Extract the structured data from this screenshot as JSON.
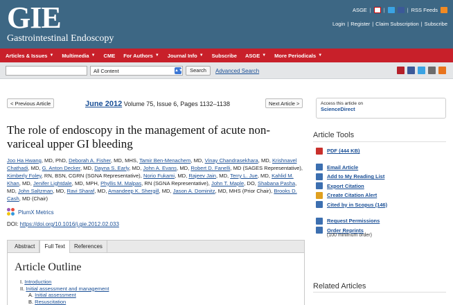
{
  "header": {
    "logo": "GIE",
    "logo_subtitle": "Gastrointestinal Endoscopy",
    "top_links": {
      "asge": "ASGE",
      "rss": "RSS Feeds"
    },
    "user_links": [
      "Login",
      "Register",
      "Claim Subscription",
      "Subscribe"
    ]
  },
  "nav": [
    {
      "label": "Articles & Issues",
      "caret": true
    },
    {
      "label": "Multimedia",
      "caret": true
    },
    {
      "label": "CME",
      "caret": false
    },
    {
      "label": "For Authors",
      "caret": true
    },
    {
      "label": "Journal Info",
      "caret": true
    },
    {
      "label": "Subscribe",
      "caret": false
    },
    {
      "label": "ASGE",
      "caret": true
    },
    {
      "label": "More Periodicals",
      "caret": true
    }
  ],
  "search": {
    "input_value": "",
    "scope": "All Content",
    "button": "Search",
    "advanced": "Advanced Search"
  },
  "share_colors": [
    "#b5202a",
    "#3b5998",
    "#3aa3e3",
    "#6c6c6c",
    "#e8741e"
  ],
  "article_nav": {
    "prev": "< Previous Article",
    "next": "Next Article >",
    "issue_link": "June 2012",
    "issue_rest": " Volume 75, Issue 6, Pages 1132–1138"
  },
  "access_box": {
    "text": "Access this article on",
    "link": "ScienceDirect"
  },
  "article": {
    "title": "The role of endoscopy in the management of acute non-variceal upper GI bleeding",
    "plumx": "PlumX Metrics",
    "doi_label": "DOI: ",
    "doi": "https://doi.org/10.1016/j.gie.2012.02.033"
  },
  "authors": [
    {
      "name": "Joo Ha Hwang",
      "suffix": ", MD, PhD, "
    },
    {
      "name": "Deborah A. Fisher",
      "suffix": ", MD, MHS, "
    },
    {
      "name": "Tamir Ben-Menachem",
      "suffix": ", MD, "
    },
    {
      "name": "Vinay Chandrasekhara",
      "suffix": ", MD, "
    },
    {
      "name": "Krishnavel Chathadi",
      "suffix": ", MD, "
    },
    {
      "name": "G. Anton Decker",
      "suffix": ", MD, "
    },
    {
      "name": "Dayna S. Early",
      "suffix": ", MD, "
    },
    {
      "name": "John A. Evans",
      "suffix": ", MD, "
    },
    {
      "name": "Robert D. Fanelli",
      "suffix": ", MD (SAGES Representative), "
    },
    {
      "name": "Kimberly Foley",
      "suffix": ", RN, BSN, CGRN (SGNA Representative), "
    },
    {
      "name": "Norio Fukami",
      "suffix": ", MD, "
    },
    {
      "name": "Rajeev Jain",
      "suffix": ", MD, "
    },
    {
      "name": "Terry L. Jue",
      "suffix": ", MD, "
    },
    {
      "name": "Kahlid M. Khan",
      "suffix": ", MD, "
    },
    {
      "name": "Jenifer Lightdale",
      "suffix": ", MD, MPH, "
    },
    {
      "name": "Phyllis M. Malpas",
      "suffix": ", RN (SGNA Representative), "
    },
    {
      "name": "John T. Maple",
      "suffix": ", DO, "
    },
    {
      "name": "Shabana Pasha",
      "suffix": ", MD, "
    },
    {
      "name": "John Saltzman",
      "suffix": ", MD, "
    },
    {
      "name": "Ravi Sharaf",
      "suffix": ", MD, "
    },
    {
      "name": "Amandeep K. Shergill",
      "suffix": ", MD, "
    },
    {
      "name": "Jason A. Dominitz",
      "suffix": ", MD, MHS (Prior Chair), "
    },
    {
      "name": "Brooks D. Cash",
      "suffix": ", MD (Chair)"
    }
  ],
  "tabs": [
    "Abstract",
    "Full Text",
    "References"
  ],
  "active_tab": "Full Text",
  "outline": {
    "title": "Article Outline",
    "items": [
      {
        "num": "I.",
        "label": "Introduction",
        "level": 0
      },
      {
        "num": "II.",
        "label": "Initial assessment and management",
        "level": 0
      },
      {
        "num": "A.",
        "label": "Initial assessment",
        "level": 1
      },
      {
        "num": "B.",
        "label": "Resuscitation",
        "level": 1
      }
    ]
  },
  "sidebar": {
    "tools_title": "Article Tools",
    "tools": [
      {
        "label": "PDF (444 KB)",
        "icon": "pdf-icon",
        "color": "#c9302c",
        "gap_after": true
      },
      {
        "label": "Email Article",
        "icon": "email-icon",
        "color": "#3c6fb0"
      },
      {
        "label": "Add to My Reading List",
        "icon": "reading-list-icon",
        "color": "#3c6fb0"
      },
      {
        "label": "Export Citation",
        "icon": "export-icon",
        "color": "#3c6fb0"
      },
      {
        "label": "Create Citation Alert",
        "icon": "bell-icon",
        "color": "#e0a020"
      },
      {
        "label": "Cited by in Scopus (146)",
        "icon": "scopus-icon",
        "color": "#3c6fb0",
        "gap_after": true
      },
      {
        "label": "Request Permissions",
        "icon": "permissions-icon",
        "color": "#3c6fb0"
      },
      {
        "label": "Order Reprints",
        "icon": "reprints-icon",
        "color": "#3c6fb0",
        "note": "(100 minimum order)"
      }
    ],
    "related_title": "Related Articles"
  }
}
